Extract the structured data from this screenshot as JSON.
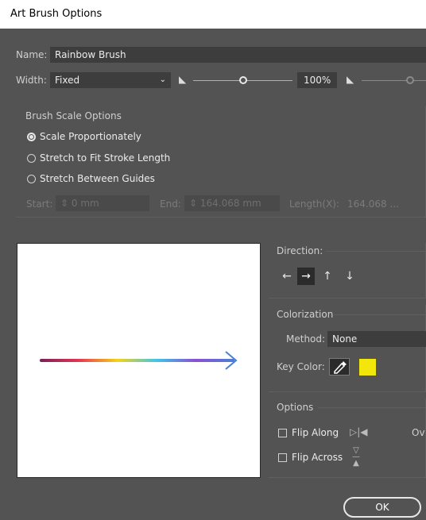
{
  "window": {
    "title": "Art Brush Options"
  },
  "name": {
    "label": "Name:",
    "value": "Rainbow Brush"
  },
  "width": {
    "label": "Width:",
    "value": "Fixed",
    "percent": "100%"
  },
  "brush_scale": {
    "title": "Brush Scale Options",
    "options": [
      "Scale Proportionately",
      "Stretch to Fit Stroke Length",
      "Stretch Between Guides"
    ],
    "selected_index": 0,
    "start_label": "Start:",
    "start_value": "0 mm",
    "end_label": "End:",
    "end_value": "164.068 mm",
    "length_label": "Length(X):",
    "length_value": "164.068 ..."
  },
  "direction": {
    "label": "Direction:",
    "arrows": [
      "←",
      "→",
      "↑",
      "↓"
    ],
    "selected_index": 1
  },
  "colorization": {
    "title": "Colorization",
    "method_label": "Method:",
    "method_value": "None",
    "key_color_label": "Key Color:",
    "key_color": "#f2e60a"
  },
  "options": {
    "title": "Options",
    "flip_along_label": "Flip Along",
    "flip_across_label": "Flip Across",
    "overlap_partial": "Ov"
  },
  "buttons": {
    "ok": "OK"
  },
  "colors": {
    "bg": "#535353",
    "field": "#3d3d3d",
    "preview_bg": "#ffffff",
    "arrow_head": "#4a7fd6"
  }
}
